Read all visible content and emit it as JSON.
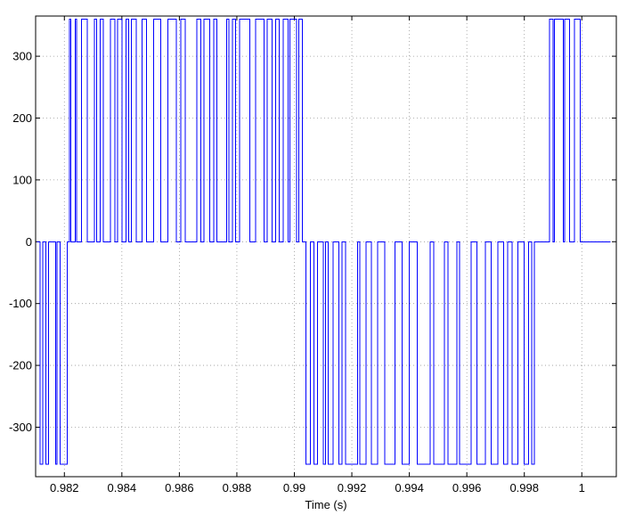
{
  "chart_data": {
    "type": "line",
    "title": "",
    "xlabel": "Time (s)",
    "ylabel": "",
    "xlim": [
      0.981,
      1.0012
    ],
    "ylim": [
      -380,
      365
    ],
    "x_ticks": [
      0.982,
      0.984,
      0.986,
      0.988,
      0.99,
      0.992,
      0.994,
      0.996,
      0.998,
      1
    ],
    "x_tick_labels": [
      "0.982",
      "0.984",
      "0.986",
      "0.988",
      "0.99",
      "0.992",
      "0.994",
      "0.996",
      "0.998",
      "1"
    ],
    "y_ticks": [
      -300,
      -200,
      -100,
      0,
      100,
      200,
      300
    ],
    "y_tick_labels": [
      "-300",
      "-200",
      "-100",
      "0",
      "100",
      "200",
      "300"
    ],
    "grid": true,
    "line_color": "#0000ff",
    "series": [
      {
        "step": true,
        "x": [
          0.98105,
          0.98115,
          0.98125,
          0.98135,
          0.98145,
          0.9817,
          0.98175,
          0.98185,
          0.9821,
          0.98218,
          0.98222,
          0.98238,
          0.98243,
          0.9826,
          0.9828,
          0.98305,
          0.98312,
          0.98325,
          0.98335,
          0.9836,
          0.98375,
          0.98385,
          0.984,
          0.98415,
          0.98423,
          0.98433,
          0.9845,
          0.9847,
          0.98485,
          0.9851,
          0.98535,
          0.9856,
          0.9859,
          0.98605,
          0.9862,
          0.9866,
          0.98675,
          0.98685,
          0.98705,
          0.9872,
          0.9873,
          0.98765,
          0.98772,
          0.98785,
          0.98795,
          0.9881,
          0.98845,
          0.98865,
          0.98895,
          0.98905,
          0.98922,
          0.98935,
          0.98948,
          0.98962,
          0.98978,
          0.98985,
          0.99008,
          0.99015,
          0.99028,
          0.9903,
          0.9904,
          0.99055,
          0.99068,
          0.9908,
          0.991,
          0.99108,
          0.99118,
          0.99135,
          0.99155,
          0.99165,
          0.99178,
          0.9922,
          0.99228,
          0.9925,
          0.99268,
          0.9929,
          0.99315,
          0.9935,
          0.99375,
          0.994,
          0.99428,
          0.99472,
          0.99485,
          0.99522,
          0.99535,
          0.99565,
          0.99575,
          0.99615,
          0.99635,
          0.99665,
          0.99685,
          0.99708,
          0.99728,
          0.99742,
          0.99758,
          0.99778,
          0.998,
          0.99815,
          0.99825,
          0.99835,
          0.99888,
          0.999,
          0.99905,
          0.99935,
          0.9994,
          0.99958,
          0.99975,
          0.99995
        ],
        "y": [
          0,
          -360,
          0,
          -360,
          0,
          -360,
          0,
          -360,
          0,
          360,
          0,
          360,
          0,
          360,
          0,
          360,
          0,
          360,
          0,
          360,
          0,
          360,
          0,
          360,
          0,
          360,
          0,
          360,
          0,
          360,
          0,
          360,
          0,
          360,
          0,
          360,
          0,
          360,
          0,
          360,
          0,
          360,
          0,
          360,
          0,
          360,
          0,
          360,
          0,
          360,
          0,
          360,
          0,
          360,
          0,
          360,
          0,
          360,
          0,
          0,
          -360,
          0,
          -360,
          0,
          -360,
          0,
          -360,
          0,
          -360,
          0,
          -360,
          0,
          -360,
          0,
          -360,
          0,
          -360,
          0,
          -360,
          0,
          -360,
          0,
          -360,
          0,
          -360,
          0,
          -360,
          0,
          -360,
          0,
          -360,
          0,
          -360,
          0,
          -360,
          0,
          -360,
          0,
          -360,
          0,
          360,
          0,
          360,
          0,
          360,
          0,
          360,
          0
        ]
      }
    ]
  }
}
